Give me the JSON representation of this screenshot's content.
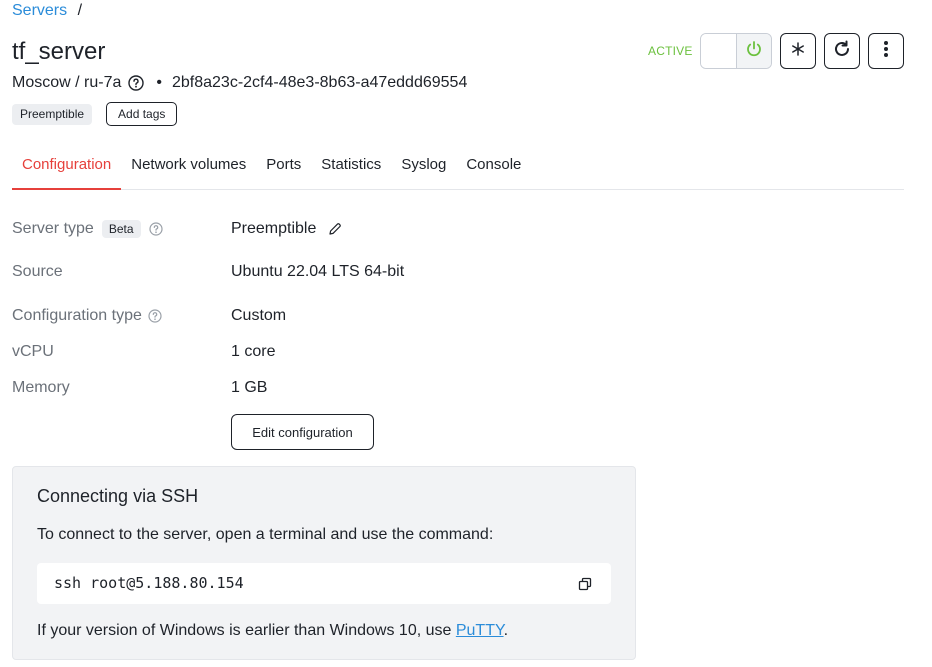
{
  "breadcrumb": {
    "link": "Servers",
    "separator": "/"
  },
  "server": {
    "name": "tf_server",
    "location": "Moscow / ru-7a",
    "bullet": "•",
    "id": "2bf8a23c-2cf4-48e3-8b63-a47eddd69554",
    "tag": "Preemptible",
    "add_tags_label": "Add tags",
    "status": "ACTIVE",
    "status_color": "#6cc13f"
  },
  "toolbar": {
    "power_icon": "power-icon",
    "freeze_icon": "snowflake-icon",
    "reboot_icon": "reboot-icon",
    "more_icon": "more-vertical-icon"
  },
  "tabs": [
    {
      "label": "Configuration",
      "active": true
    },
    {
      "label": "Network volumes",
      "active": false
    },
    {
      "label": "Ports",
      "active": false
    },
    {
      "label": "Statistics",
      "active": false
    },
    {
      "label": "Syslog",
      "active": false
    },
    {
      "label": "Console",
      "active": false
    }
  ],
  "config": {
    "server_type_label": "Server type",
    "beta_badge": "Beta",
    "server_type_value": "Preemptible",
    "source_label": "Source",
    "source_value": "Ubuntu 22.04 LTS 64-bit",
    "config_type_label": "Configuration type",
    "config_type_value": "Custom",
    "vcpu_label": "vCPU",
    "vcpu_value": "1 core",
    "memory_label": "Memory",
    "memory_value": "1 GB",
    "edit_button": "Edit configuration"
  },
  "ssh": {
    "title": "Connecting via SSH",
    "description": "To connect to the server, open a terminal and use the command:",
    "command": "ssh root@5.188.80.154",
    "footer_prefix": "If your version of Windows is earlier than Windows 10, use ",
    "footer_link": "PuTTY",
    "footer_suffix": "."
  },
  "colors": {
    "accent": "#e6403b",
    "link": "#2b8cd9",
    "status": "#6cc13f"
  }
}
